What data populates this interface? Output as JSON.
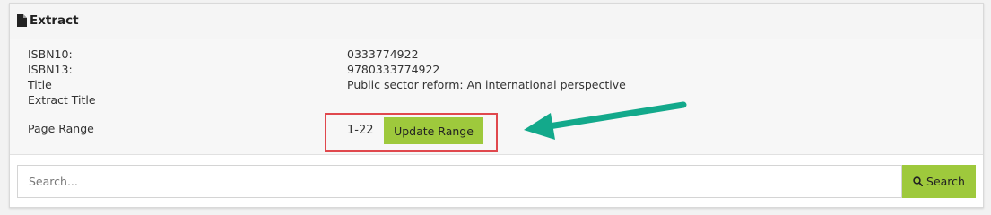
{
  "panel": {
    "title": "Extract",
    "icon": "file-icon"
  },
  "details": {
    "isbn10_label": "ISBN10:",
    "isbn10_value": "0333774922",
    "isbn13_label": "ISBN13:",
    "isbn13_value": "9780333774922",
    "title_label": "Title",
    "title_value": "Public sector reform: An international perspective",
    "extract_title_label": "Extract Title",
    "extract_title_value": "",
    "page_range_label": "Page Range",
    "page_range_value": "1-22"
  },
  "actions": {
    "update_range_label": "Update Range"
  },
  "search": {
    "placeholder": "Search...",
    "value": "",
    "button_label": "Search"
  },
  "colors": {
    "accent_green": "#9ec93c",
    "highlight_red": "#e0484d",
    "arrow_teal": "#13a98b"
  }
}
